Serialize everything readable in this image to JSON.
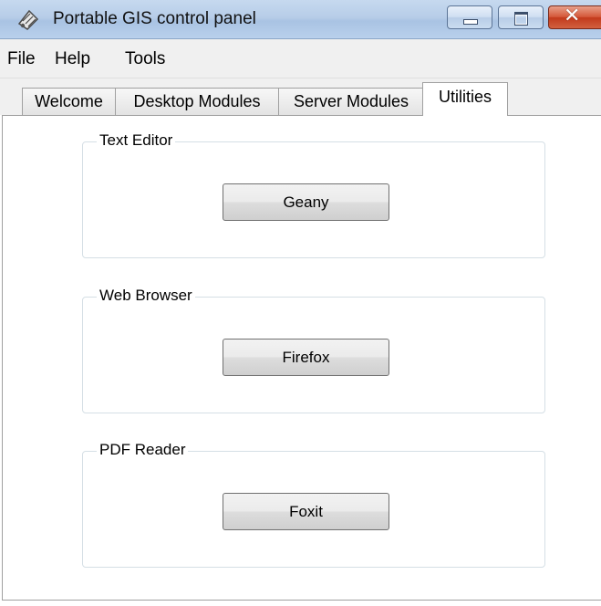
{
  "window": {
    "title": "Portable GIS control panel",
    "accent_close": "#c8472a",
    "titlebar_color": "#b9d1ea"
  },
  "icons": {
    "app": "gis-app-icon",
    "minimize": "minimize-icon",
    "maximize": "maximize-icon",
    "close": "close-icon"
  },
  "menu": {
    "items": [
      {
        "label": "File"
      },
      {
        "label": "Help"
      },
      {
        "label": "Tools"
      }
    ]
  },
  "tabs": [
    {
      "label": "Welcome",
      "active": false
    },
    {
      "label": "Desktop Modules",
      "active": false
    },
    {
      "label": "Server Modules",
      "active": false
    },
    {
      "label": "Utilities",
      "active": true
    }
  ],
  "utilities": {
    "groups": [
      {
        "title": "Text Editor",
        "button": "Geany"
      },
      {
        "title": "Web Browser",
        "button": "Firefox"
      },
      {
        "title": "PDF Reader",
        "button": "Foxit"
      }
    ]
  },
  "close_glyph": "✕"
}
